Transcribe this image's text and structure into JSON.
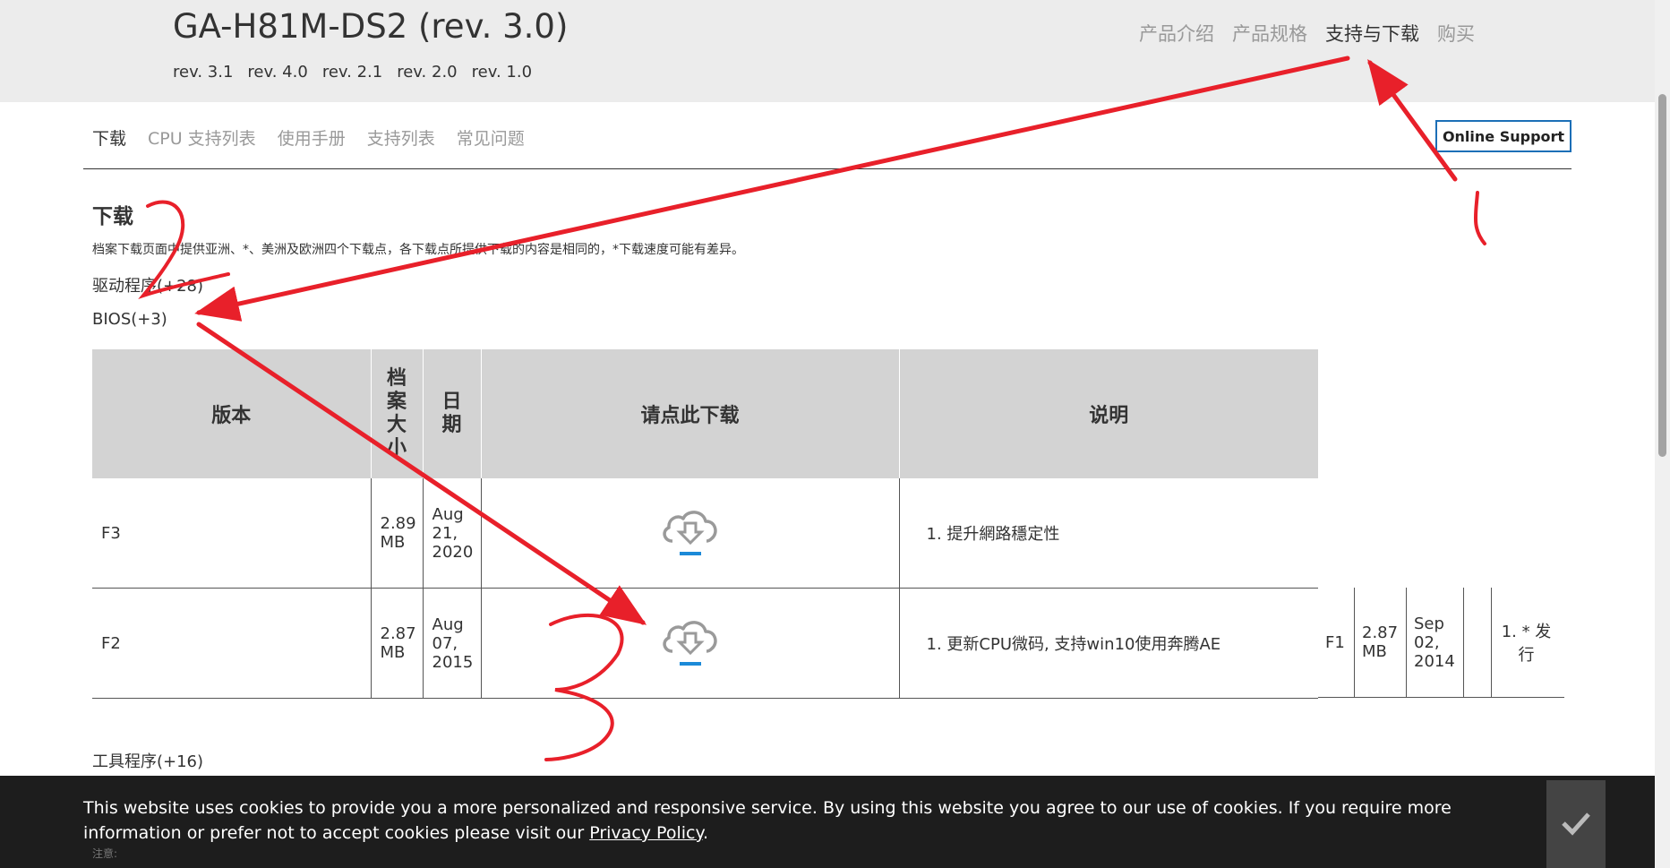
{
  "header": {
    "title": "GA-H81M-DS2 (rev. 3.0)",
    "revisions": [
      "rev. 3.1",
      "rev. 4.0",
      "rev. 2.1",
      "rev. 2.0",
      "rev. 1.0"
    ],
    "nav": [
      "产品介绍",
      "产品规格",
      "支持与下载",
      "购买"
    ]
  },
  "subnav": {
    "items": [
      "下载",
      "CPU 支持列表",
      "使用手册",
      "支持列表",
      "常见问题"
    ],
    "online_support": "Online Support"
  },
  "downloads": {
    "title": "下载",
    "description": "档案下载页面中提供亚洲、*、美洲及欧洲四个下载点，各下载点所提供下载的内容是相同的，*下载速度可能有差异。",
    "categories": [
      "驱动程序(+28)",
      "BIOS(+3)",
      "工具程序(+16)"
    ]
  },
  "bios_table": {
    "headers": [
      "版本",
      "档案大小",
      "日期",
      "请点此下载",
      "说明"
    ],
    "rows": [
      {
        "version": "F3",
        "size": "2.89 MB",
        "date": "Aug 21, 2020",
        "desc": "1. 提升網路穩定性"
      },
      {
        "version": "F2",
        "size": "2.87 MB",
        "date": "Aug 07, 2015",
        "desc": "1. 更新CPU微码, 支持win10使用奔腾AE"
      }
    ],
    "overflow_row": {
      "version": "F1",
      "size": "2.87 MB",
      "date": "Sep 02, 2014",
      "desc": "1. * 发行"
    }
  },
  "annotations": {
    "label_1": "1",
    "label_2": "2",
    "label_3": "3",
    "color": "#e8202a"
  },
  "cookie": {
    "text": "This website uses cookies to provide you a more personalized and responsive service. By using this website you agree to our use of cookies. If you require more information or prefer not to accept cookies please visit our ",
    "link": "Privacy Policy",
    "tail": "."
  },
  "note": "注意:",
  "colors": {
    "accent": "#1c6fb7",
    "header_bg": "#ececec",
    "table_header_bg": "#d3d3d3",
    "banner_bg": "#1d1d1d"
  }
}
